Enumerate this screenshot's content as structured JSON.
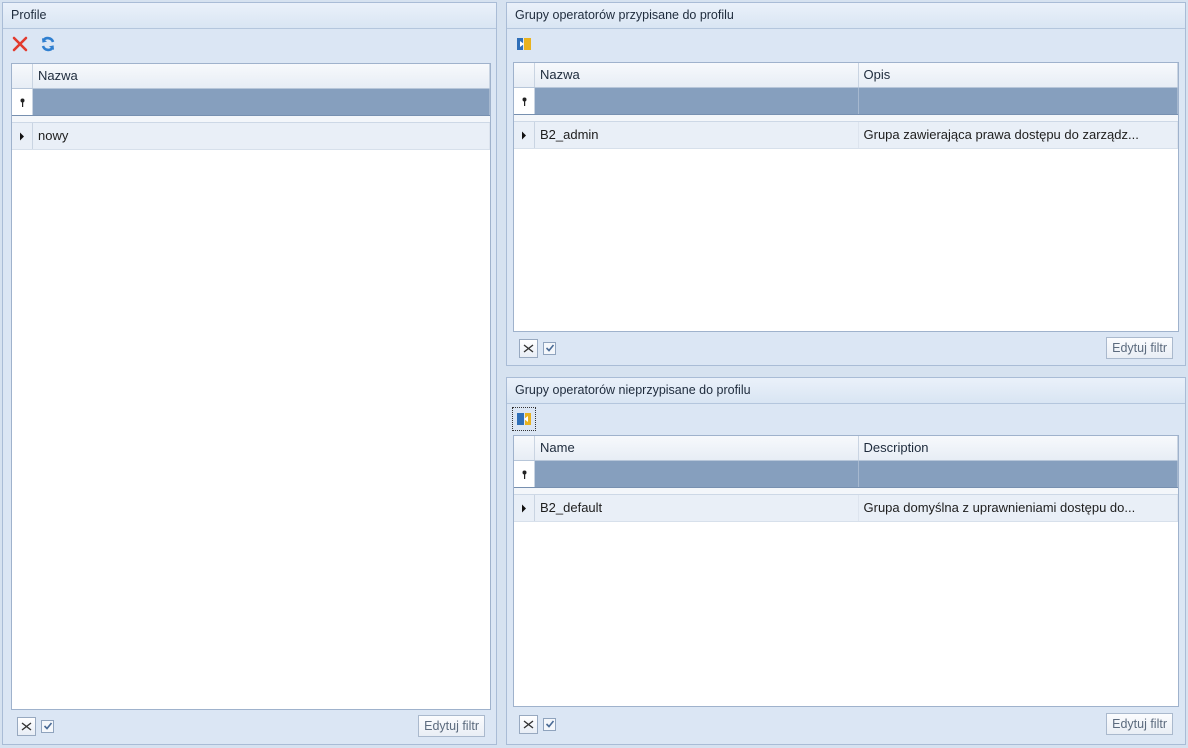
{
  "profile": {
    "title": "Profile",
    "toolbar": {
      "delete_icon": "delete-x-icon",
      "refresh_icon": "refresh-icon"
    },
    "columns": [
      "Nazwa"
    ],
    "rows": [
      {
        "name": "nowy"
      }
    ],
    "footer": {
      "edit_filter": "Edytuj filtr",
      "checked": true
    }
  },
  "assigned": {
    "title": "Grupy operatorów przypisane do profilu",
    "toolbar": {
      "unassign_icon": "unassign-group-icon"
    },
    "columns": [
      "Nazwa",
      "Opis"
    ],
    "rows": [
      {
        "name": "B2_admin",
        "description": "Grupa zawierająca prawa dostępu do zarządz..."
      }
    ],
    "footer": {
      "edit_filter": "Edytuj filtr",
      "checked": true
    }
  },
  "unassigned": {
    "title": "Grupy operatorów nieprzypisane do profilu",
    "toolbar": {
      "assign_icon": "assign-group-icon"
    },
    "columns": [
      "Name",
      "Description"
    ],
    "rows": [
      {
        "name": "B2_default",
        "description": "Grupa domyślna z uprawnieniami dostępu do..."
      }
    ],
    "footer": {
      "edit_filter": "Edytuj filtr",
      "checked": true
    }
  },
  "colors": {
    "background": "#d6e2f0",
    "filter_row": "#869fbe",
    "selected_row": "#e9eff7",
    "delete_red": "#e23b2e",
    "refresh_blue": "#2f7fd0"
  }
}
